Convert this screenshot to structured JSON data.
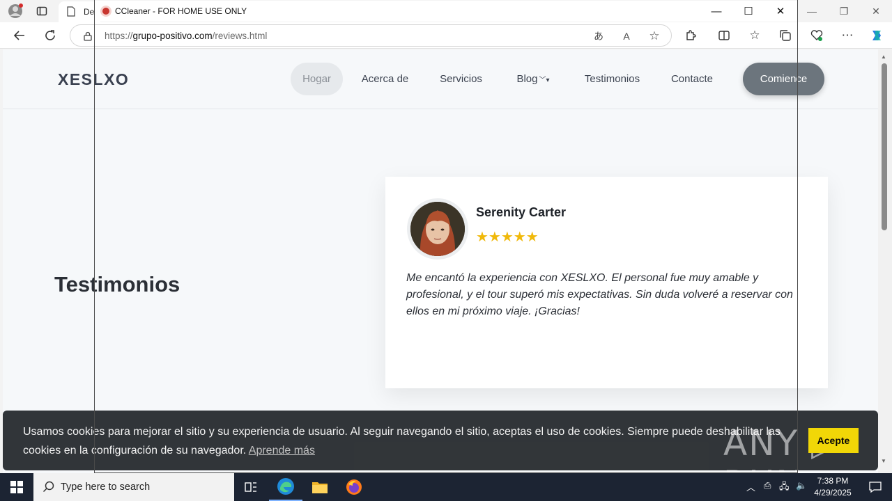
{
  "browser": {
    "tab_label": "De",
    "url_scheme": "https://",
    "url_host": "grupo-positivo.com",
    "url_path": "/reviews.html"
  },
  "ccleaner": {
    "title": "CCleaner - FOR HOME USE ONLY"
  },
  "site": {
    "logo": "XESLXO",
    "nav": [
      "Hogar",
      "Acerca de",
      "Servicios",
      "Blog",
      "Testimonios",
      "Contacte"
    ],
    "cta": "Comience",
    "section_title": "Testimonios"
  },
  "testimonial": {
    "name": "Serenity Carter",
    "rating": 5,
    "stars": "★★★★★",
    "quote": " Me encantó la experiencia con XESLXO. El personal fue muy amable y profesional, y el tour superó mis expectativas. Sin duda volveré a reservar con ellos en mi próximo viaje. ¡Gracias!"
  },
  "cookie_banner": {
    "text": "Usamos cookies para mejorar el sitio y su experiencia de usuario. Al seguir navegando el sitio, aceptas el uso de cookies. Siempre puede deshabilitar las cookies en la configuración de su navegador.",
    "link": "Aprende más",
    "button": "Acepte"
  },
  "watermark": "ANY ▷ RUN",
  "taskbar": {
    "search_placeholder": "Type here to search",
    "time": "7:38 PM",
    "date": "4/29/2025"
  },
  "colors": {
    "cta_bg": "#6c757d",
    "cookie_bg": "#2b2f33",
    "cookie_button": "#f1d600",
    "stars": "#f0b90b",
    "taskbar": "#1c2433"
  }
}
